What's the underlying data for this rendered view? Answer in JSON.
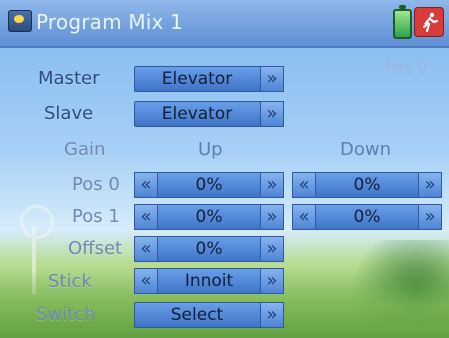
{
  "title_bar": {
    "title": "Program Mix 1",
    "icons": [
      "app-icon",
      "battery-icon",
      "runner-icon"
    ]
  },
  "pos_indicator": "Pos 0",
  "rows": {
    "master": {
      "label": "Master",
      "value": "Elevator"
    },
    "slave": {
      "label": "Slave",
      "value": "Elevator"
    },
    "gain": {
      "label": "Gain",
      "up": "Up",
      "down": "Down"
    },
    "pos0": {
      "label": "Pos 0",
      "up_value": "0%",
      "down_value": "0%"
    },
    "pos1": {
      "label": "Pos 1",
      "up_value": "0%",
      "down_value": "0%"
    },
    "offset": {
      "label": "Offset",
      "value": "0%"
    },
    "stick": {
      "label": "Stick",
      "value": "Innoit"
    },
    "switch": {
      "label": "Switch",
      "value": "Select"
    }
  },
  "buttons": {
    "left": "«",
    "right": "»"
  }
}
